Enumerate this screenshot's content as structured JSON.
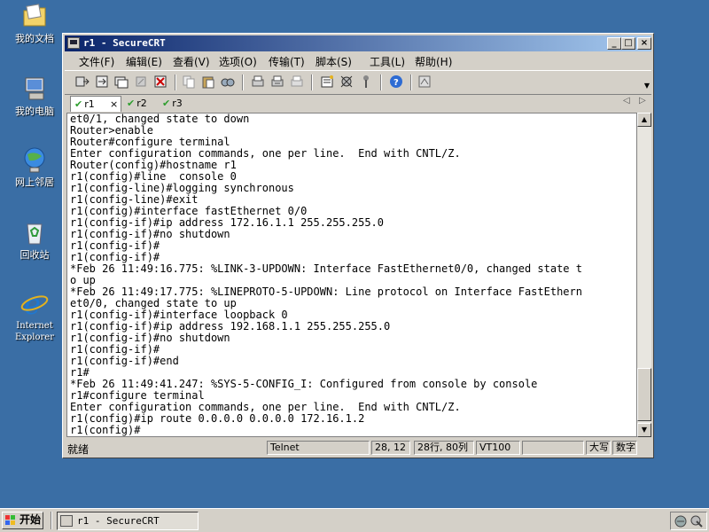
{
  "desktop": {
    "icons": [
      {
        "label": "我的文档",
        "icon": "my-documents-icon"
      },
      {
        "label": "我的电脑",
        "icon": "my-computer-icon"
      },
      {
        "label": "网上邻居",
        "icon": "network-places-icon"
      },
      {
        "label": "回收站",
        "icon": "recycle-bin-icon"
      },
      {
        "label": "Internet Explorer",
        "icon": "internet-explorer-icon"
      }
    ]
  },
  "window": {
    "title": "r1 - SecureCRT",
    "buttons": {
      "minimize": "_",
      "maximize": "□",
      "close": "×"
    },
    "menu": [
      "文件(F)",
      "编辑(E)",
      "查看(V)",
      "选项(O)",
      "传输(T)",
      "脚本(S)",
      "工具(L)",
      "帮助(H)"
    ],
    "tabs": [
      {
        "label": "r1",
        "active": true,
        "close": "×"
      },
      {
        "label": "r2",
        "active": false
      },
      {
        "label": "r3",
        "active": false
      }
    ],
    "tab_nav": {
      "prev": "◁",
      "next": "▷"
    },
    "terminal_lines": [
      "et0/1, changed state to down",
      "Router>enable",
      "Router#configure terminal",
      "Enter configuration commands, one per line.  End with CNTL/Z.",
      "Router(config)#hostname r1",
      "r1(config)#line  console 0",
      "r1(config-line)#logging synchronous",
      "r1(config-line)#exit",
      "r1(config)#interface fastEthernet 0/0",
      "r1(config-if)#ip address 172.16.1.1 255.255.255.0",
      "r1(config-if)#no shutdown",
      "r1(config-if)#",
      "r1(config-if)#",
      "*Feb 26 11:49:16.775: %LINK-3-UPDOWN: Interface FastEthernet0/0, changed state t",
      "o up",
      "*Feb 26 11:49:17.775: %LINEPROTO-5-UPDOWN: Line protocol on Interface FastEthern",
      "et0/0, changed state to up",
      "r1(config-if)#interface loopback 0",
      "r1(config-if)#ip address 192.168.1.1 255.255.255.0",
      "r1(config-if)#no shutdown",
      "r1(config-if)#",
      "r1(config-if)#end",
      "r1#",
      "*Feb 26 11:49:41.247: %SYS-5-CONFIG_I: Configured from console by console",
      "r1#configure terminal",
      "Enter configuration commands, one per line.  End with CNTL/Z.",
      "r1(config)#ip route 0.0.0.0 0.0.0.0 172.16.1.2",
      "r1(config)#"
    ],
    "status": {
      "ready": "就绪",
      "protocol": "Telnet",
      "cursor": "28, 12",
      "rows_cols": "28行, 80列",
      "emulation": "VT100",
      "caps": "大写",
      "num": "数字"
    }
  },
  "taskbar": {
    "start_label": "开始",
    "task_title": "r1 - SecureCRT"
  }
}
